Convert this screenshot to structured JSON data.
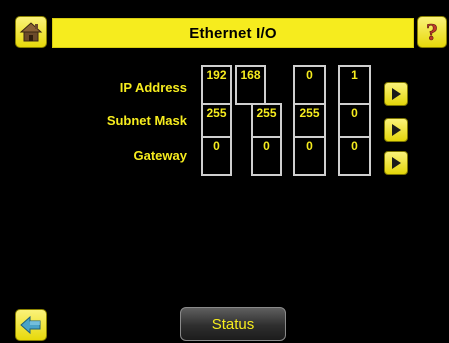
{
  "header": {
    "title": "Ethernet I/O",
    "home_icon": "home-icon",
    "help_icon": "help-icon"
  },
  "form": {
    "rows": [
      {
        "label": "IP Address",
        "octets": [
          "192",
          "168",
          "0",
          "1"
        ]
      },
      {
        "label": "Subnet Mask",
        "octets": [
          "255",
          "255",
          "255",
          "0"
        ]
      },
      {
        "label": "Gateway",
        "octets": [
          "0",
          "0",
          "0",
          "0"
        ]
      }
    ]
  },
  "footer": {
    "status_label": "Status",
    "back_icon": "back-arrow-icon"
  },
  "colors": {
    "accent": "#f6ec1e",
    "background": "#000000",
    "cell_border": "#cfcfcf"
  }
}
